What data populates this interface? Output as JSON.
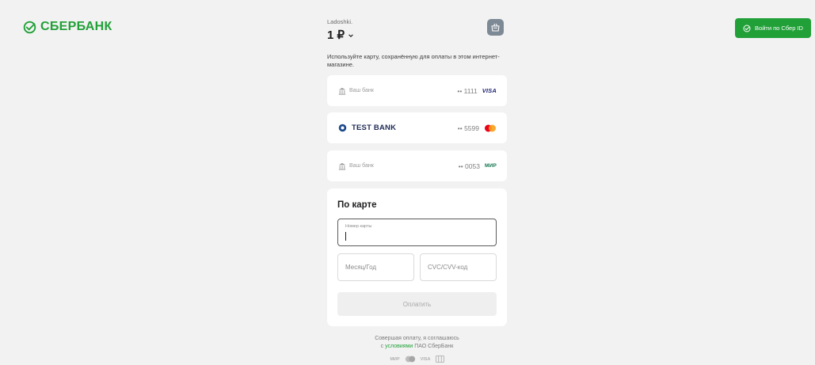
{
  "header": {
    "logo_text": "СБЕРБАНК",
    "merchant": "Ladoshki.",
    "amount": "1 ₽",
    "sber_id_button": "Войти по Сбер ID"
  },
  "hint": "Используйте карту, сохранённую для оплаты в этом интернет-магазине.",
  "saved_cards": [
    {
      "bank": "Ваш банк",
      "mask": "•• 1111",
      "system": "VISA",
      "bank_icon": "bank-building-icon"
    },
    {
      "bank": "TEST BANK",
      "mask": "•• 5599",
      "system": "mastercard",
      "bank_icon": "test-bank-logo-icon"
    },
    {
      "bank": "Ваш банк",
      "mask": "•• 0053",
      "system": "МИР",
      "bank_icon": "bank-building-icon"
    }
  ],
  "card_form": {
    "title": "По карте",
    "card_number_label": "Номер карты",
    "card_number_value": "",
    "expiry_placeholder": "Месяц/Год",
    "cvc_placeholder": "CVC/CVV-код",
    "pay_button": "Оплатить"
  },
  "footer": {
    "agree_line1": "Совершая оплату, я соглашаюсь",
    "agree_prefix": "с",
    "agree_link": "условиями",
    "agree_suffix": "ПАО СберБанк",
    "payment_systems": [
      "МИР",
      "mastercard",
      "VISA",
      "card"
    ]
  },
  "colors": {
    "brand_green": "#21a038",
    "background": "#f2f2f2",
    "basket_button": "#7d8a95"
  }
}
